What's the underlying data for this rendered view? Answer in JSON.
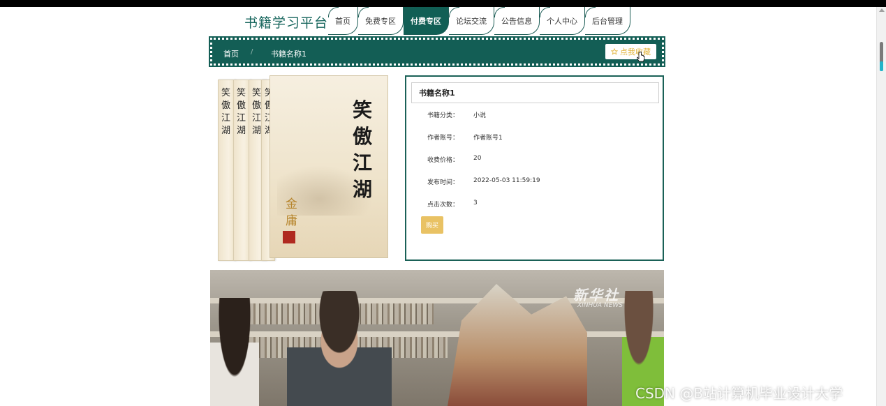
{
  "header": {
    "site_title": "书籍学习平台",
    "nav": [
      "首页",
      "免费专区",
      "付费专区",
      "论坛交流",
      "公告信息",
      "个人中心",
      "后台管理"
    ],
    "active_nav": "付费专区"
  },
  "breadcrumb": {
    "home": "首页",
    "separator": "/",
    "current": "书籍名称1",
    "favorite_label": "点我收藏",
    "favorite_icon": "star-outline-icon"
  },
  "cover": {
    "spine_title": "笑傲江湖",
    "front_title": "笑傲江湖",
    "front_author": "金庸"
  },
  "detail": {
    "title": "书籍名称1",
    "fields": [
      {
        "label": "书籍分类：",
        "value": "小说"
      },
      {
        "label": "作者账号：",
        "value": "作者账号1"
      },
      {
        "label": "收费价格：",
        "value": "20"
      },
      {
        "label": "发布时间：",
        "value": "2022-05-03 11:59:19"
      },
      {
        "label": "点击次数：",
        "value": "3"
      }
    ],
    "buy_label": "购买"
  },
  "video": {
    "watermark_cn": "新华社",
    "watermark_en": "XINHUA NEWS"
  },
  "overlay": {
    "csdn": "CSDN @B站计算机毕业设计大学"
  },
  "colors": {
    "primary": "#135e55",
    "accent": "#e9c264"
  }
}
